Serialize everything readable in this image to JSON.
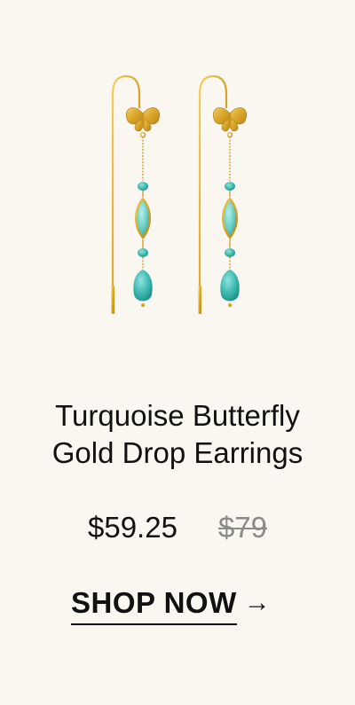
{
  "product": {
    "title_line1": "Turquoise Butterfly",
    "title_line2": "Gold Drop Earrings",
    "sale_price": "$59.25",
    "original_price": "$79",
    "image_icon": "turquoise-butterfly-earrings-image"
  },
  "cta": {
    "label": "SHOP NOW",
    "arrow": "→"
  },
  "colors": {
    "background": "#faf7f1",
    "gold": "#d9a82e",
    "turquoise": "#3cb8b0",
    "text": "#111111",
    "muted": "#8a8a8a"
  }
}
